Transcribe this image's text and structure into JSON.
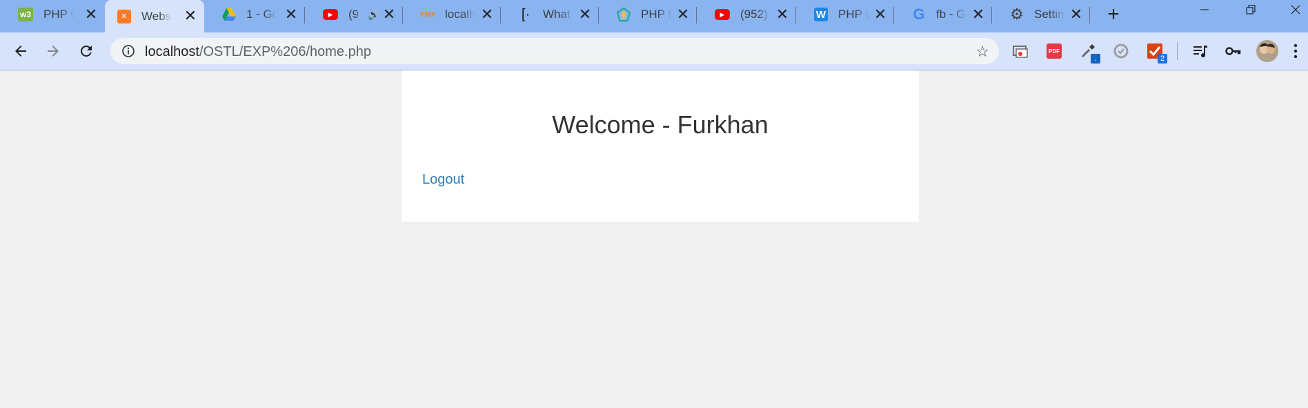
{
  "browser": {
    "tabs": [
      {
        "title": "PHP C",
        "icon": "w3schools-icon",
        "active": false
      },
      {
        "title": "Websi",
        "icon": "xampp-icon",
        "active": true
      },
      {
        "title": "1 - Go",
        "icon": "google-drive-icon",
        "active": false
      },
      {
        "title": "(9",
        "icon": "youtube-icon",
        "active": false,
        "audio": true
      },
      {
        "title": "localh",
        "icon": "phpmyadmin-icon",
        "active": false
      },
      {
        "title": "What",
        "icon": "brackets-icon",
        "active": false
      },
      {
        "title": "PHP R",
        "icon": "php-r-icon",
        "active": false
      },
      {
        "title": "(952)",
        "icon": "youtube-icon",
        "active": false
      },
      {
        "title": "PHP L",
        "icon": "w-icon",
        "active": false
      },
      {
        "title": "fb - G",
        "icon": "google-icon",
        "active": false
      },
      {
        "title": "Settin",
        "icon": "gear-icon",
        "active": false
      }
    ],
    "address": {
      "host": "localhost",
      "path": "/OSTL/EXP%206/home.php"
    },
    "extensions": {
      "todo_badge": "2",
      "picker_badge": "."
    }
  },
  "page": {
    "heading": "Welcome - Furkhan",
    "logout_label": "Logout"
  },
  "colors": {
    "tabstrip": "#8ab4f0",
    "toolbar": "#d6e3fb",
    "page_bg": "#f0f0f0",
    "link": "#337ab7",
    "heading": "#333333"
  }
}
